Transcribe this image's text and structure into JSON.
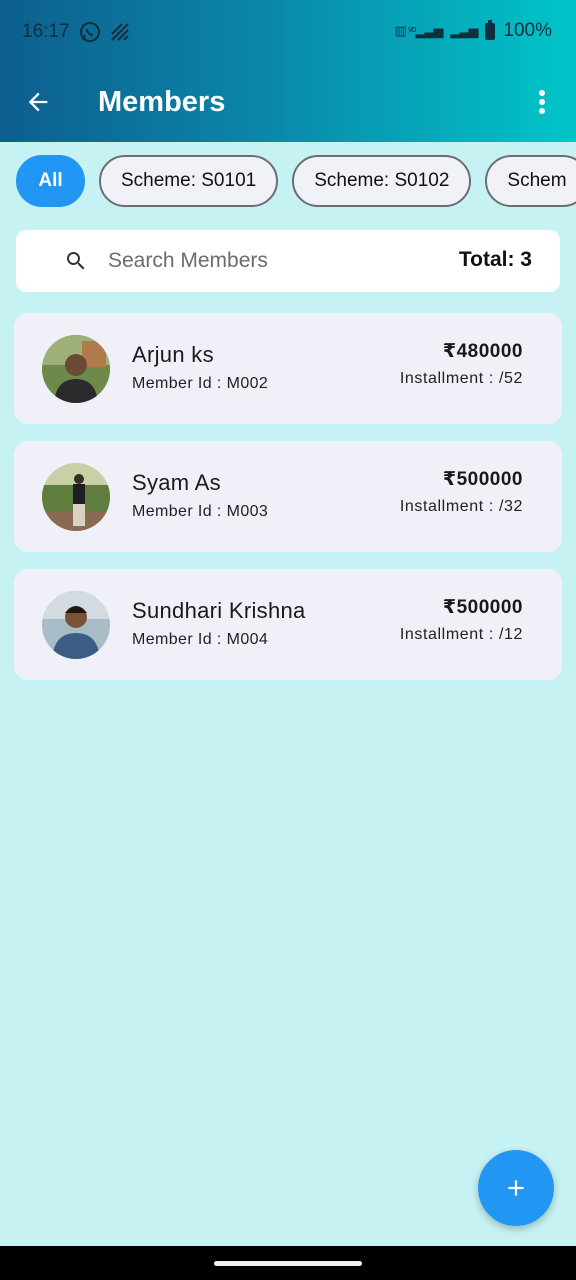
{
  "status_bar": {
    "time": "16:17",
    "battery": "100%",
    "icons": [
      "whatsapp-icon",
      "no-signal-icon",
      "volte-icon",
      "signal-icon",
      "battery-icon"
    ]
  },
  "appbar": {
    "title": "Members",
    "icons": [
      "arrow-back-icon",
      "more-vert-icon"
    ]
  },
  "filters": {
    "chips": [
      {
        "label": "All",
        "selected": true
      },
      {
        "label": "Scheme: S0101",
        "selected": false
      },
      {
        "label": "Scheme: S0102",
        "selected": false
      },
      {
        "label": "Schem",
        "selected": false
      }
    ]
  },
  "search": {
    "placeholder": "Search Members",
    "value": "",
    "total": "Total: 3"
  },
  "members": [
    {
      "name": "Arjun ks",
      "member_id": "Member Id : M002",
      "amount": "₹480000",
      "installment": "Installment : /52"
    },
    {
      "name": "Syam As",
      "member_id": "Member Id : M003",
      "amount": "₹500000",
      "installment": "Installment : /32"
    },
    {
      "name": "Sundhari Krishna",
      "member_id": "Member Id : M004",
      "amount": "₹500000",
      "installment": "Installment : /12"
    }
  ],
  "fab": {
    "icon": "add-icon"
  },
  "colors": {
    "background": "#c6f2f3",
    "header_start": "#0d5e8f",
    "header_end": "#00c5c9",
    "accent": "#2196f3",
    "card": "#eff0f8"
  }
}
